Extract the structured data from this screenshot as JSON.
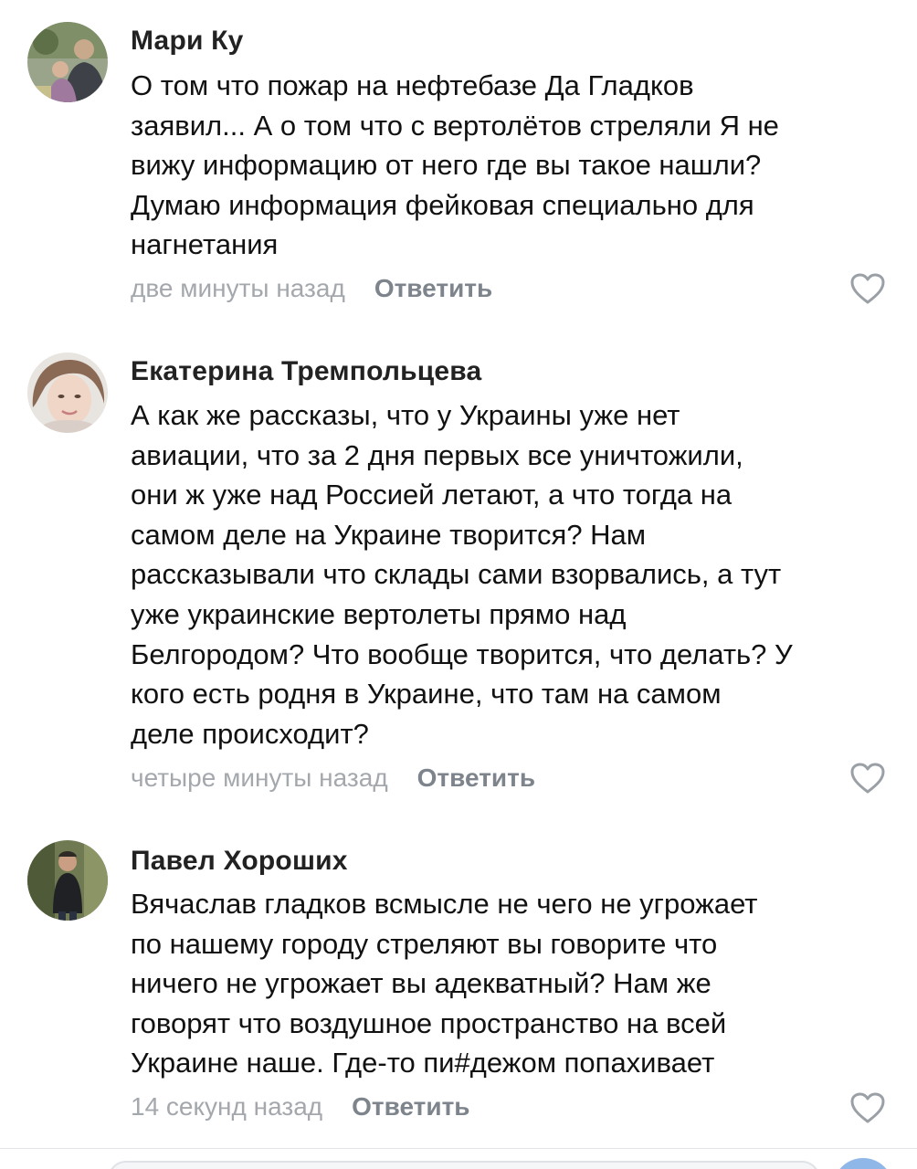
{
  "comments": [
    {
      "author": "Мари Ку",
      "lines": [
        "О том что пожар на нефтебазе Да Гладков",
        "заявил... А о том что с вертолётов стреляли Я не",
        "вижу информацию от него где вы такое нашли?",
        "Думаю информация фейковая специально для",
        "нагнетания"
      ],
      "time": "две минуты назад",
      "reply_label": "Ответить",
      "like_icon": "heart-outline-icon"
    },
    {
      "author": "Екатерина Тремпольцева",
      "lines": [
        "А как же рассказы, что у Украины уже нет",
        "авиации, что за 2 дня первых все уничтожили,",
        "они ж уже над Россией летают, а что тогда на",
        "самом деле на Украине творится? Нам",
        "рассказывали что склады сами взорвались, а тут",
        "уже украинские вертолеты прямо над",
        "Белгородом? Что вообще творится, что делать? У",
        "кого есть родня в Украине, что там на самом",
        "деле происходит?"
      ],
      "time": "четыре минуты назад",
      "reply_label": "Ответить",
      "like_icon": "heart-outline-icon"
    },
    {
      "author": "Павел Хороших",
      "lines": [
        "Вячаслав гладков всмысле не чего не угрожает",
        "по нашему городу стреляют вы говорите что",
        "ничего не угрожает вы адекватный? Нам же",
        "говорят что воздушное пространство на всей",
        "Украине наше. Где-то пи#дежом попахивает"
      ],
      "time": "14 секунд назад",
      "reply_label": "Ответить",
      "like_icon": "heart-outline-icon"
    }
  ],
  "colors": {
    "author": "#222222",
    "text": "#111111",
    "time": "#a4a8ad",
    "reply": "#7d848c",
    "like": "#9aa0a6",
    "send_button": "#8fb7e8"
  }
}
